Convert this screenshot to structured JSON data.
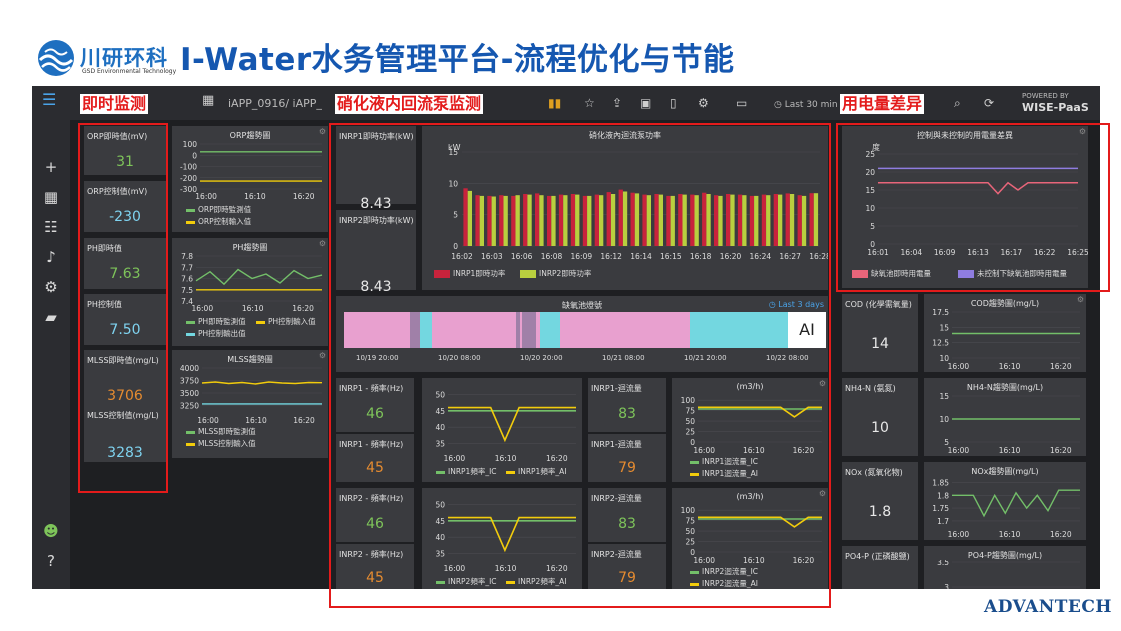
{
  "header": {
    "logo_text": "川研环科",
    "logo_sub": "GSD Environmental Technology",
    "title": "I-Water水务管理平台-流程优化与节能",
    "footer_logo": "ADVANTECH"
  },
  "topbar": {
    "breadcrumb": "iAPP_0916/ iAPP_",
    "time_range": "Last 30 min",
    "powered_by": "POWERED BY",
    "wisepaas": "WISE-PaaS"
  },
  "callouts": {
    "realtime": "即时监测",
    "pump": "硝化液内回流泵监测",
    "power": "用电量差异"
  },
  "left": {
    "orp_now_label": "ORP即時值(mV)",
    "orp_now": "31",
    "orp_ctrl_label": "ORP控制值(mV)",
    "orp_ctrl": "-230",
    "ph_now_label": "PH即時值",
    "ph_now": "7.63",
    "ph_ctrl_label": "PH控制值",
    "ph_ctrl": "7.50",
    "mlss_now_label": "MLSS即時值(mg/L)",
    "mlss_now": "3706",
    "mlss_ctrl_label": "MLSS控制值(mg/L)",
    "mlss_ctrl": "3283",
    "orp_trend_title": "ORP趨勢圖",
    "orp_leg1": "ORP即時監測值",
    "orp_leg2": "ORP控制輸入值",
    "ph_trend_title": "PH趨勢圖",
    "ph_leg1": "PH即時監測值",
    "ph_leg2": "PH控制輸入值",
    "ph_leg3": "PH控制輸出值",
    "mlss_trend_title": "MLSS趨勢圖",
    "mlss_leg1": "MLSS即時監測值",
    "mlss_leg2": "MLSS控制輸入值"
  },
  "middle": {
    "p1_label": "INRP1即時功率(kW)",
    "p1_value": "8.43",
    "p2_label": "INRP2即時功率(kW)",
    "p2_value": "8.43",
    "power_chart_title": "硝化液內迴流泵功率",
    "power_leg1": "INRP1即時功率",
    "power_leg2": "INRP2即時功率",
    "anoxic_title": "缺氧池燈號",
    "anoxic_range": "Last 3 days",
    "anoxic_tag": "AI",
    "inrp1_freq_label": "INRP1 - 頻率(Hz)",
    "inrp1_freq_a": "46",
    "inrp1_freq_b": "45",
    "inrp1_flow_label": "INRP1-迴流量",
    "inrp1_flow_a": "83",
    "inrp1_flow_b": "79",
    "inrp2_freq_label": "INRP2 - 頻率(Hz)",
    "inrp2_freq_a": "46",
    "inrp2_freq_b": "45",
    "inrp2_flow_label": "INRP2-迴流量",
    "inrp2_flow_a": "83",
    "inrp2_flow_b": "79",
    "flow_unit": "(m3/h)",
    "f1_leg1": "INRP1頻率_IC",
    "f1_leg2": "INRP1頻率_AI",
    "q1_leg1": "INRP1迴流量_IC",
    "q1_leg2": "INRP1迴流量_AI",
    "f2_leg1": "INRP2頻率_IC",
    "f2_leg2": "INRP2頻率_AI",
    "q2_leg1": "INRP2迴流量_IC",
    "q2_leg2": "INRP2迴流量_AI"
  },
  "right": {
    "usage_title": "控制與未控制的用電量差異",
    "usage_leg1": "缺氧池即時用電量",
    "usage_leg2": "未控制下缺氧池即時用電量",
    "cod_label": "COD (化學需氧量)",
    "cod": "14",
    "cod_trend": "COD趨勢圖(mg/L)",
    "nh4_label": "NH4-N (氨氮)",
    "nh4": "10",
    "nh4_trend": "NH4-N趨勢圖(mg/L)",
    "nox_label": "NOx (氮氧化物)",
    "nox": "1.8",
    "nox_trend": "NOx趨勢圖(mg/L)",
    "po4_label": "PO4-P (正磷酸鹽)",
    "po4_trend": "PO4-P趨勢圖(mg/L)"
  },
  "colors": {
    "red": "#c8233c",
    "lime": "#b9cf3f",
    "green": "#73bf69",
    "yellow": "#f2cc0c",
    "cyan": "#73d7e0",
    "pink": "#e8a0cf",
    "purple": "#8f7de0",
    "salmon": "#e8657a"
  },
  "chart_data": [
    {
      "type": "line",
      "title": "ORP趨勢圖",
      "x": [
        "16:00",
        "16:10",
        "16:20"
      ],
      "yticks": [
        100,
        0,
        -100,
        -200,
        -300
      ],
      "series": [
        {
          "name": "ORP即時監測值",
          "values": [
            31,
            31,
            31
          ]
        },
        {
          "name": "ORP控制輸入值",
          "values": [
            -230,
            -230,
            -230
          ]
        }
      ]
    },
    {
      "type": "line",
      "title": "PH趨勢圖",
      "x": [
        "16:00",
        "16:10",
        "16:20"
      ],
      "yticks": [
        7.8,
        7.7,
        7.6,
        7.5,
        7.4
      ],
      "ylim": [
        7.4,
        7.8
      ],
      "series": [
        {
          "name": "PH即時監測值",
          "values": [
            7.58,
            7.66,
            7.55,
            7.68,
            7.6,
            7.64,
            7.56,
            7.67,
            7.6,
            7.63
          ]
        },
        {
          "name": "PH控制輸入值",
          "values": [
            7.5,
            7.5,
            7.5,
            7.5,
            7.5,
            7.5,
            7.5,
            7.5,
            7.5,
            7.5
          ]
        }
      ]
    },
    {
      "type": "line",
      "title": "MLSS趨勢圖",
      "x": [
        "16:00",
        "16:10",
        "16:20"
      ],
      "yticks": [
        4000,
        3750,
        3500,
        3250
      ],
      "ylim": [
        3100,
        4000
      ],
      "series": [
        {
          "name": "MLSS即時監測值",
          "values": [
            3700,
            3720,
            3690,
            3710,
            3680,
            3720,
            3700,
            3690,
            3710,
            3706
          ]
        },
        {
          "name": "MLSS控制輸入值",
          "values": [
            3283,
            3283,
            3283,
            3283,
            3283,
            3283,
            3283,
            3283,
            3283,
            3283
          ]
        }
      ]
    },
    {
      "type": "bar",
      "title": "硝化液內迴流泵功率",
      "ylabel": "kW",
      "ylim": [
        0,
        15
      ],
      "yticks": [
        0,
        5,
        10,
        15
      ],
      "xticks": [
        "16:02",
        "16:03",
        "16:06",
        "16:08",
        "16:09",
        "16:12",
        "16:14",
        "16:15",
        "16:18",
        "16:20",
        "16:24",
        "16:27",
        "16:28"
      ],
      "series": [
        {
          "name": "INRP1即時功率",
          "values": [
            9.2,
            8.1,
            8.0,
            8.1,
            8.0,
            8.3,
            8.4,
            8.0,
            8.2,
            8.3,
            8.0,
            8.2,
            8.6,
            9.0,
            8.5,
            8.2,
            8.3,
            8.0,
            8.3,
            8.2,
            8.5,
            8.1,
            8.3,
            8.2,
            8.0,
            8.2,
            8.3,
            8.4,
            8.1,
            8.43
          ]
        },
        {
          "name": "INRP2即時功率",
          "values": [
            8.8,
            8.0,
            7.9,
            8.0,
            8.1,
            8.2,
            8.1,
            8.0,
            8.1,
            8.2,
            8.0,
            8.1,
            8.3,
            8.7,
            8.4,
            8.1,
            8.2,
            8.0,
            8.2,
            8.1,
            8.3,
            8.0,
            8.2,
            8.1,
            8.0,
            8.1,
            8.2,
            8.3,
            8.0,
            8.43
          ]
        }
      ]
    },
    {
      "type": "line",
      "title": "控制與未控制的用電量差異",
      "ylabel": "度",
      "ylim": [
        0,
        25
      ],
      "yticks": [
        0,
        5,
        10,
        15,
        20,
        25
      ],
      "xticks": [
        "16:01",
        "16:04",
        "16:09",
        "16:13",
        "16:17",
        "16:22",
        "16:25"
      ],
      "series": [
        {
          "name": "缺氧池即時用電量",
          "values": [
            17,
            17,
            17,
            17,
            17,
            17,
            17,
            17,
            17,
            17,
            17,
            17,
            14,
            17,
            15,
            17,
            17,
            17,
            17,
            17,
            17
          ]
        },
        {
          "name": "未控制下缺氧池即時用電量",
          "values": [
            21,
            21,
            21,
            21,
            21,
            21,
            21,
            21,
            21,
            21,
            21,
            21,
            21,
            21,
            21,
            21,
            21,
            21,
            21,
            21,
            21
          ]
        }
      ]
    },
    {
      "type": "line",
      "title": "INRP1 頻率",
      "x": [
        "16:00",
        "16:10",
        "16:20"
      ],
      "yticks": [
        50,
        45,
        40,
        35
      ],
      "ylim": [
        33,
        52
      ],
      "series": [
        {
          "name": "INRP1頻率_IC",
          "values": [
            45,
            45,
            45,
            45,
            45,
            45,
            45,
            45,
            45,
            45
          ]
        },
        {
          "name": "INRP1頻率_AI",
          "values": [
            46,
            46,
            46,
            46,
            36,
            46,
            46,
            46,
            46,
            46
          ]
        }
      ]
    },
    {
      "type": "line",
      "title": "INRP1 迴流量",
      "x": [
        "16:00",
        "16:10",
        "16:20"
      ],
      "yticks": [
        100,
        75,
        50,
        25,
        0
      ],
      "ylim": [
        0,
        110
      ],
      "series": [
        {
          "name": "INRP1迴流量_IC",
          "values": [
            79,
            79,
            79,
            79,
            79,
            79,
            79,
            79,
            79,
            79
          ]
        },
        {
          "name": "INRP1迴流量_AI",
          "values": [
            83,
            83,
            83,
            83,
            83,
            83,
            83,
            60,
            83,
            83
          ]
        }
      ]
    },
    {
      "type": "line",
      "title": "INRP2 頻率",
      "x": [
        "16:00",
        "16:10",
        "16:20"
      ],
      "yticks": [
        50,
        45,
        40,
        35
      ],
      "ylim": [
        33,
        52
      ],
      "series": [
        {
          "name": "INRP2頻率_IC",
          "values": [
            45,
            45,
            45,
            45,
            45,
            45,
            45,
            45,
            45,
            45
          ]
        },
        {
          "name": "INRP2頻率_AI",
          "values": [
            46,
            46,
            46,
            46,
            36,
            46,
            46,
            46,
            46,
            46
          ]
        }
      ]
    },
    {
      "type": "line",
      "title": "INRP2 迴流量",
      "x": [
        "16:00",
        "16:10",
        "16:20"
      ],
      "yticks": [
        100,
        75,
        50,
        25,
        0
      ],
      "ylim": [
        0,
        110
      ],
      "series": [
        {
          "name": "INRP2迴流量_IC",
          "values": [
            79,
            79,
            79,
            79,
            79,
            79,
            79,
            79,
            79,
            79
          ]
        },
        {
          "name": "INRP2迴流量_AI",
          "values": [
            83,
            83,
            83,
            83,
            83,
            83,
            83,
            60,
            83,
            83
          ]
        }
      ]
    },
    {
      "type": "line",
      "title": "COD趨勢圖(mg/L)",
      "x": [
        "16:00",
        "16:10",
        "16:20"
      ],
      "yticks": [
        17.5,
        15,
        12.5,
        10
      ],
      "ylim": [
        10,
        17.5
      ],
      "series": [
        {
          "values": [
            14,
            14,
            14
          ]
        }
      ]
    },
    {
      "type": "line",
      "title": "NH4-N趨勢圖(mg/L)",
      "x": [
        "16:00",
        "16:10",
        "16:20"
      ],
      "yticks": [
        15,
        10,
        5
      ],
      "ylim": [
        5,
        15
      ],
      "series": [
        {
          "values": [
            10,
            10,
            10
          ]
        }
      ]
    },
    {
      "type": "line",
      "title": "NOx趨勢圖(mg/L)",
      "x": [
        "16:00",
        "16:10",
        "16:20"
      ],
      "yticks": [
        1.85,
        1.8,
        1.75,
        1.7
      ],
      "ylim": [
        1.68,
        1.86
      ],
      "series": [
        {
          "values": [
            1.8,
            1.8,
            1.8,
            1.72,
            1.8,
            1.73,
            1.81,
            1.75,
            1.8,
            1.74,
            1.82,
            1.82,
            1.82
          ]
        }
      ]
    },
    {
      "type": "line",
      "title": "PO4-P趨勢圖(mg/L)",
      "yticks": [
        3.5,
        3.0
      ]
    }
  ]
}
